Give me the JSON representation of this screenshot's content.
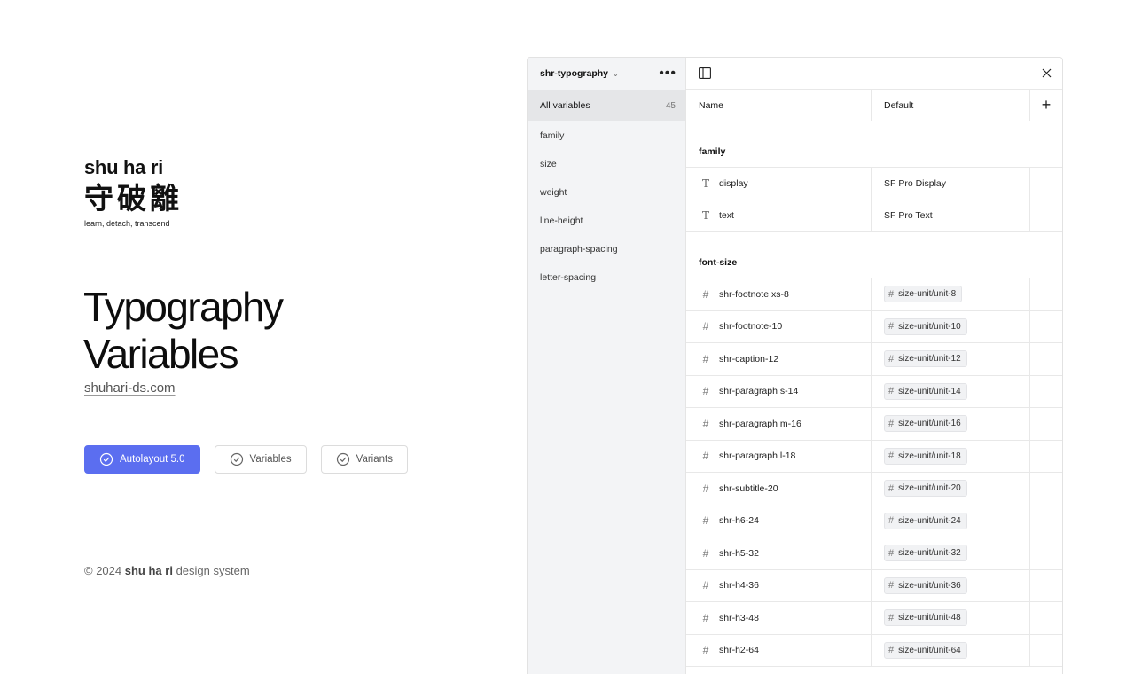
{
  "brand": {
    "name": "shu ha ri",
    "kanji": "守破離",
    "tagline": "learn, detach, transcend"
  },
  "hero": {
    "title_line1": "Typography",
    "title_line2": "Variables",
    "link": "shuhari-ds.com"
  },
  "badges": [
    {
      "label": "Autolayout 5.0",
      "primary": true
    },
    {
      "label": "Variables",
      "primary": false
    },
    {
      "label": "Variants",
      "primary": false
    }
  ],
  "footer": {
    "prefix": "© 2024",
    "brand": "shu ha ri",
    "suffix": "design system"
  },
  "panel": {
    "collection": "shr-typography",
    "sidebar": [
      {
        "label": "All variables",
        "count": "45",
        "active": true
      },
      {
        "label": "family"
      },
      {
        "label": "size"
      },
      {
        "label": "weight"
      },
      {
        "label": "line-height"
      },
      {
        "label": "paragraph-spacing"
      },
      {
        "label": "letter-spacing"
      }
    ],
    "columns": {
      "name": "Name",
      "default": "Default"
    },
    "groups": [
      {
        "title": "family",
        "icon": "text-type-icon",
        "rows": [
          {
            "name": "display",
            "value": "SF Pro Display",
            "alias": false
          },
          {
            "name": "text",
            "value": "SF Pro Text",
            "alias": false
          }
        ]
      },
      {
        "title": "font-size",
        "icon": "hash-icon",
        "rows": [
          {
            "name": "shr-footnote xs-8",
            "value": "size-unit/unit-8",
            "alias": true
          },
          {
            "name": "shr-footnote-10",
            "value": "size-unit/unit-10",
            "alias": true
          },
          {
            "name": "shr-caption-12",
            "value": "size-unit/unit-12",
            "alias": true
          },
          {
            "name": "shr-paragraph s-14",
            "value": "size-unit/unit-14",
            "alias": true
          },
          {
            "name": "shr-paragraph m-16",
            "value": "size-unit/unit-16",
            "alias": true
          },
          {
            "name": "shr-paragraph l-18",
            "value": "size-unit/unit-18",
            "alias": true
          },
          {
            "name": "shr-subtitle-20",
            "value": "size-unit/unit-20",
            "alias": true
          },
          {
            "name": "shr-h6-24",
            "value": "size-unit/unit-24",
            "alias": true
          },
          {
            "name": "shr-h5-32",
            "value": "size-unit/unit-32",
            "alias": true
          },
          {
            "name": "shr-h4-36",
            "value": "size-unit/unit-36",
            "alias": true
          },
          {
            "name": "shr-h3-48",
            "value": "size-unit/unit-48",
            "alias": true
          },
          {
            "name": "shr-h2-64",
            "value": "size-unit/unit-64",
            "alias": true
          }
        ]
      }
    ]
  },
  "colors": {
    "accent": "#5b6ef0",
    "sidebar_bg": "#f3f4f6"
  }
}
